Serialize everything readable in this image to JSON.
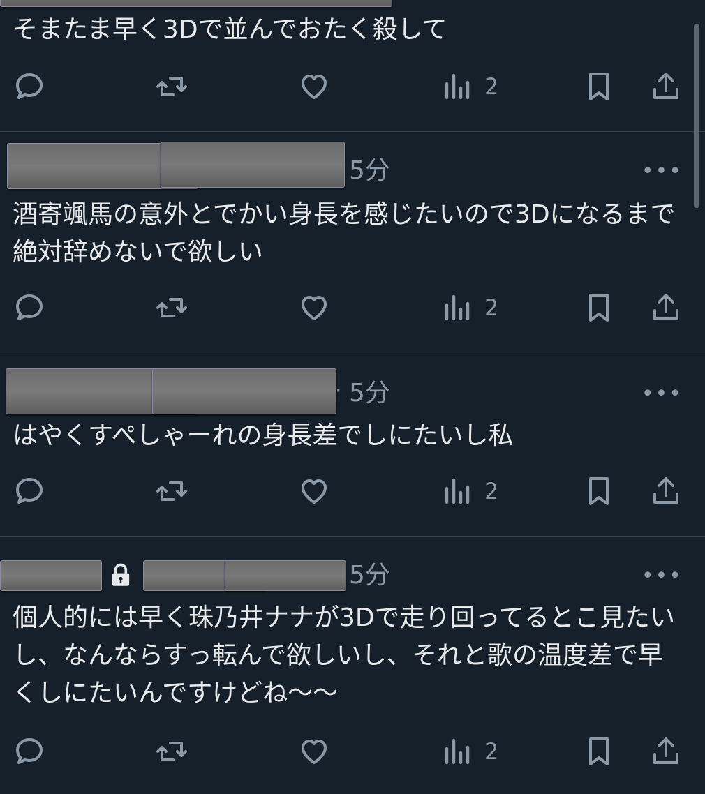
{
  "tweets": [
    {
      "time": "",
      "text": "そまたま早く3Dで並んでおたく殺して",
      "views": "2"
    },
    {
      "time": "5分",
      "text": "酒寄颯馬の意外とでかい身長を感じたいので3Dになるまで絶対辞めないで欲しい",
      "views": "2"
    },
    {
      "time": "5分",
      "dot": "·",
      "text": "はやくすぺしゃーれの身長差でしにたいし私",
      "views": "2"
    },
    {
      "time": "5分",
      "text": "個人的には早く珠乃井ナナが3Dで走り回ってるとこ見たいし、なんならすっ転んで欲しいし、それと歌の温度差で早くしにたいんですけどね〜〜",
      "views": "2"
    }
  ],
  "more_label": "•••",
  "icons": {
    "reply": "reply-icon",
    "retweet": "retweet-icon",
    "like": "like-icon",
    "views": "views-icon",
    "bookmark": "bookmark-icon",
    "share": "share-icon",
    "lock": "lock-icon"
  },
  "colors": {
    "background": "#15202b",
    "text": "#e7e9ea",
    "secondary": "#8b98a5",
    "divider": "#38444d"
  }
}
